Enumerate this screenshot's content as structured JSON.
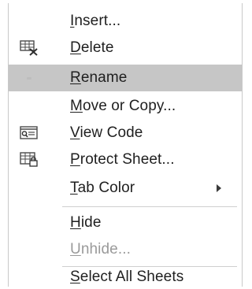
{
  "menu": {
    "items": [
      {
        "pre": "",
        "mn": "I",
        "post": "nsert..."
      },
      {
        "pre": "",
        "mn": "D",
        "post": "elete"
      },
      {
        "pre": "",
        "mn": "R",
        "post": "ename"
      },
      {
        "pre": "",
        "mn": "M",
        "post": "ove or Copy..."
      },
      {
        "pre": "",
        "mn": "V",
        "post": "iew Code"
      },
      {
        "pre": "",
        "mn": "P",
        "post": "rotect Sheet..."
      },
      {
        "pre": "",
        "mn": "T",
        "post": "ab Color"
      },
      {
        "pre": "",
        "mn": "H",
        "post": "ide"
      },
      {
        "pre": "",
        "mn": "U",
        "post": "nhide..."
      },
      {
        "pre": "",
        "mn": "S",
        "post": "elect All Sheets"
      }
    ],
    "icons": {
      "delete": "delete-sheet-icon",
      "rename": "rename-dot-icon",
      "view_code": "view-code-icon",
      "protect_sheet": "protect-sheet-icon",
      "tab_color": "submenu-arrow-icon"
    },
    "colors": {
      "highlight": "#c6c6c6",
      "text": "#1f1f1f",
      "disabled_text": "#9a9a9a",
      "icon": "#4a4a4a"
    }
  }
}
